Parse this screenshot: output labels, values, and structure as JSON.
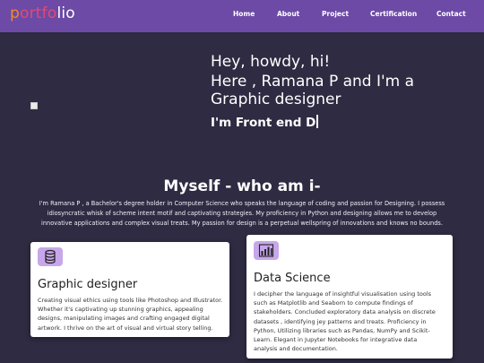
{
  "nav": {
    "logo_part1": "p",
    "logo_part2": "ortfo",
    "logo_part3": "lio",
    "links": [
      "Home",
      "About",
      "Project",
      "Certification",
      "Contact"
    ]
  },
  "hero": {
    "line1": "Hey, howdy, hi!",
    "line2": "Here , Ramana P and I'm a",
    "line3": "Graphic designer",
    "typed": "I'm Front end D"
  },
  "about": {
    "title": "Myself - who am i-",
    "lines": [
      "I'm Ramana P , a Bachelor's degree holder in Computer Science who speaks the language of coding and passion for Designing. I possess",
      "idiosyncratic whisk of scheme intent motif and captivating strategies. My proficiency in Python and designing allows me to develop",
      "innovative applications and complex visual treats. My passion for design is a perpetual wellspring of innovations and knows no bounds."
    ]
  },
  "cards": [
    {
      "icon": "database-icon",
      "title": "Graphic designer",
      "lines": [
        "Creating visual ethics using tools like Photoshop and Illustrator.",
        "Whether it's captivating up stunning graphics, appealing",
        "designs, manipulating images and crafting engaged digital",
        "artwork. I thrive on the art of visual and virtual story telling."
      ]
    },
    {
      "icon": "bar-chart-icon",
      "title": "Data Science",
      "lines": [
        "I decipher the language of insightful visualisation using tools",
        "such as Matplotlib and Seaborn to compute findings of",
        "stakeholders. Concluded exploratory data analysis on discrete",
        "datasets , identifying jey patterns and treats. Proficiency in",
        "Python, Utilizing libraries such as Pandas, NumPy and Scikit-",
        "Learn. Elegant in Jupyter Notebooks for integrative data",
        "analysis and documentation."
      ]
    }
  ],
  "colors": {
    "navbar": "#6c4aa6",
    "background": "#2e2b42",
    "logo_orange": "#f28a24",
    "logo_pink": "#e04a74",
    "icon_bg": "#c7a7ea"
  }
}
